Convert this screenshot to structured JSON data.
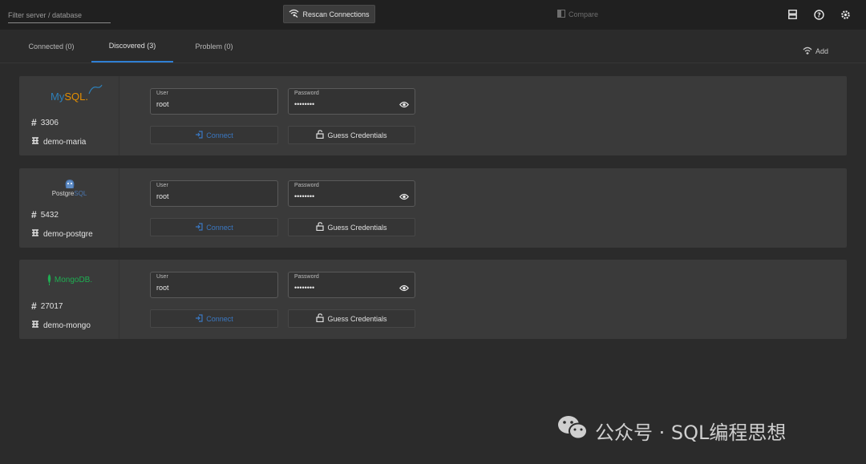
{
  "topbar": {
    "filter_placeholder": "Filter server / database",
    "rescan_label": "Rescan Connections",
    "compare_label": "Compare",
    "icons": [
      "database-icon",
      "help-icon",
      "settings-icon"
    ]
  },
  "tabs": [
    {
      "label": "Connected (0)",
      "active": false
    },
    {
      "label": "Discovered (3)",
      "active": true
    },
    {
      "label": "Problem (0)",
      "active": false
    }
  ],
  "add_label": "Add",
  "cards": [
    {
      "db": "MySQL",
      "logo_text_a": "My",
      "logo_text_b": "SQL",
      "port": "3306",
      "name": "demo-maria",
      "user_label": "User",
      "user_value": "root",
      "password_label": "Password",
      "password_value": "••••••••",
      "connect_label": "Connect",
      "guess_label": "Guess Credentials"
    },
    {
      "db": "PostgreSQL",
      "logo_text_a": "Postgre",
      "logo_text_b": "SQL",
      "port": "5432",
      "name": "demo-postgre",
      "user_label": "User",
      "user_value": "root",
      "password_label": "Password",
      "password_value": "••••••••",
      "connect_label": "Connect",
      "guess_label": "Guess Credentials"
    },
    {
      "db": "MongoDB",
      "logo_text_a": "MongoDB",
      "logo_text_b": ".",
      "port": "27017",
      "name": "demo-mongo",
      "user_label": "User",
      "user_value": "root",
      "password_label": "Password",
      "password_value": "••••••••",
      "connect_label": "Connect",
      "guess_label": "Guess Credentials"
    }
  ],
  "watermark": "公众号 · SQL编程思想",
  "colors": {
    "accent": "#2f7fd4",
    "connect_text": "#3a78c2",
    "mysql_blue": "#2d7fb8",
    "mysql_orange": "#e48e00",
    "mongo_green": "#1fae52"
  }
}
